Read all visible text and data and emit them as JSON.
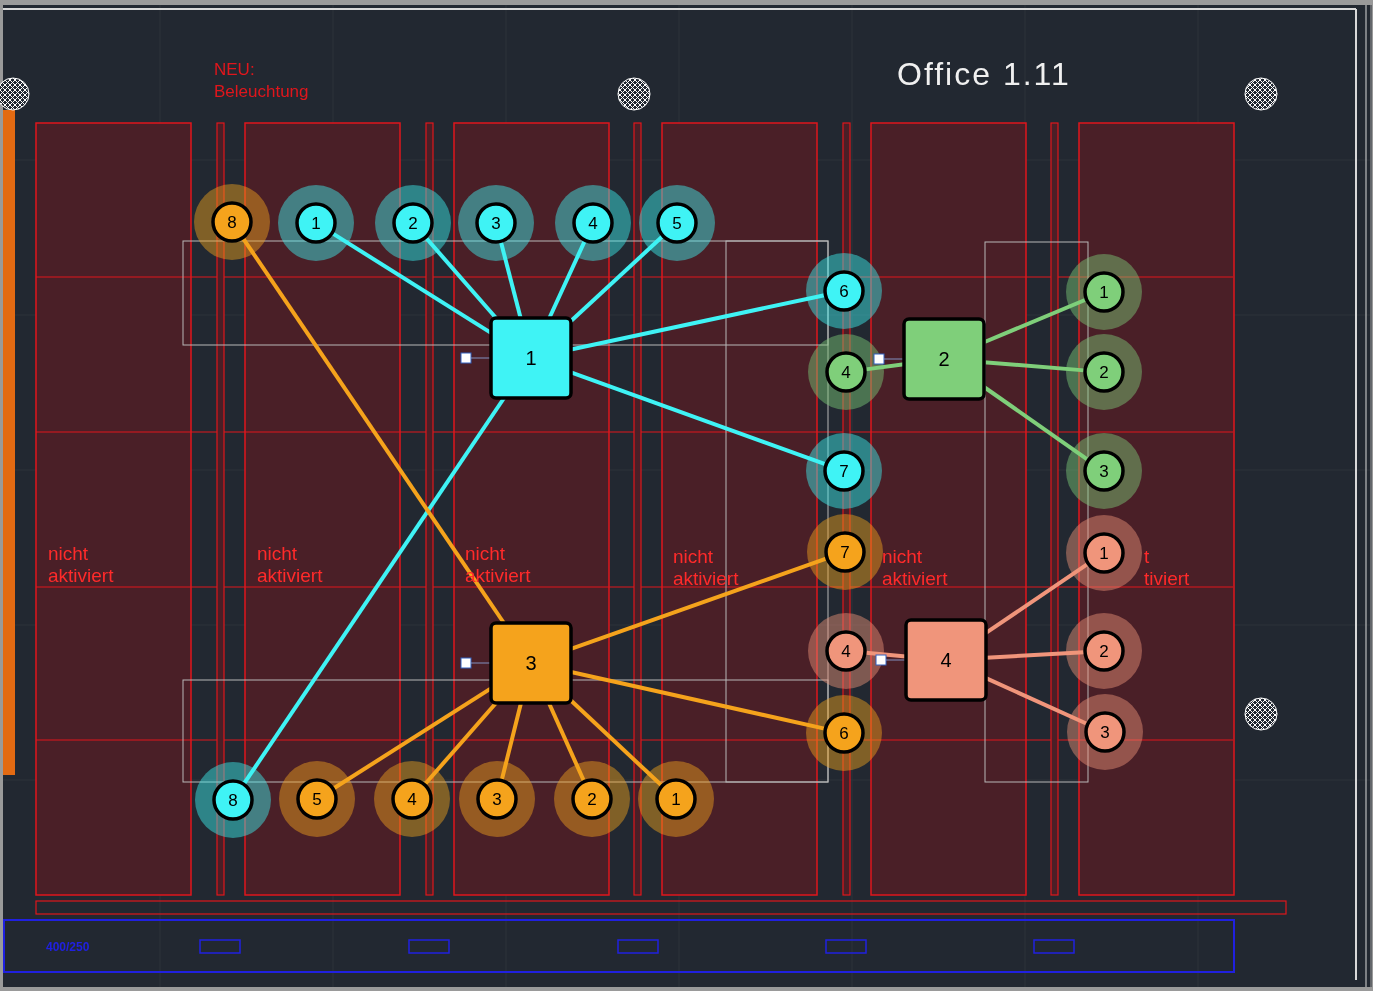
{
  "title": {
    "text": "Office 1.11"
  },
  "note": {
    "lines": [
      "NEU:",
      "Beleuchtung"
    ]
  },
  "rooms": [
    {
      "lines": [
        "nicht",
        "aktiviert"
      ]
    },
    {
      "lines": [
        "nicht",
        "aktiviert"
      ]
    },
    {
      "lines": [
        "nicht",
        "aktiviert"
      ]
    },
    {
      "lines": [
        "nicht",
        "aktiviert"
      ]
    },
    {
      "lines": [
        "nicht",
        "aktiviert"
      ]
    },
    {
      "lines": [
        "t",
        "tiviert"
      ]
    }
  ],
  "duct": {
    "label": "400/250"
  },
  "groups": [
    {
      "color": "#3ff3f5",
      "hub": {
        "label": "1"
      },
      "nodes": [
        {
          "label": "1"
        },
        {
          "label": "2"
        },
        {
          "label": "3"
        },
        {
          "label": "4"
        },
        {
          "label": "5"
        },
        {
          "label": "6"
        },
        {
          "label": "7"
        },
        {
          "label": "8"
        }
      ]
    },
    {
      "color": "#7fcf7a",
      "hub": {
        "label": "2"
      },
      "nodes": [
        {
          "label": "4"
        },
        {
          "label": "1"
        },
        {
          "label": "2"
        },
        {
          "label": "3"
        }
      ]
    },
    {
      "color": "#f5a31c",
      "hub": {
        "label": "3"
      },
      "nodes": [
        {
          "label": "8"
        },
        {
          "label": "7"
        },
        {
          "label": "6"
        },
        {
          "label": "5"
        },
        {
          "label": "4"
        },
        {
          "label": "3"
        },
        {
          "label": "2"
        },
        {
          "label": "1"
        }
      ]
    },
    {
      "color": "#f0957b",
      "hub": {
        "label": "4"
      },
      "nodes": [
        {
          "label": "4"
        },
        {
          "label": "1"
        },
        {
          "label": "2"
        },
        {
          "label": "3"
        }
      ]
    }
  ]
}
